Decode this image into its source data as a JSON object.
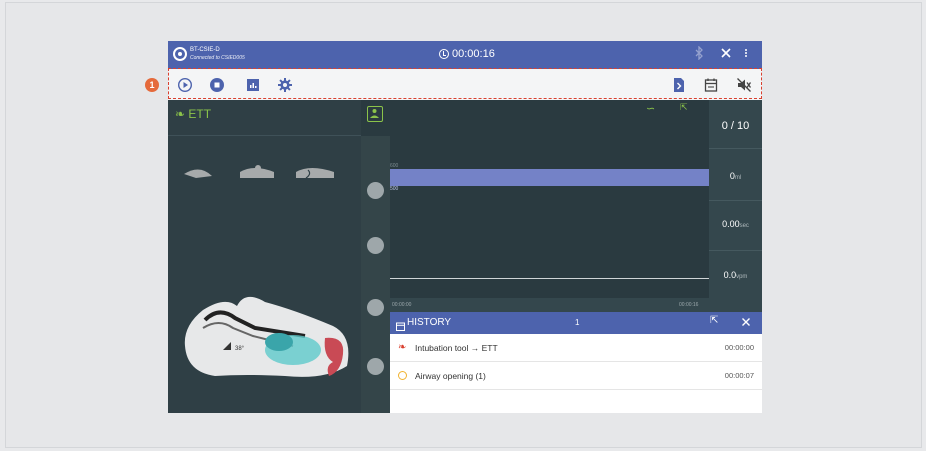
{
  "topbar": {
    "device_name": "BT-CSIE-D",
    "device_status": "Connected to CSIED005",
    "timer": "00:00:16"
  },
  "toolbar": {
    "left_icons": [
      "play-icon",
      "stop-icon",
      "report-icon",
      "settings-icon"
    ],
    "right_icons": [
      "export-icon",
      "calendar-icon",
      "mute-icon"
    ]
  },
  "annotation": {
    "badge": "1",
    "color": "#d9402f"
  },
  "left_panel": {
    "title": "ETT"
  },
  "chart": {
    "y_top_label": "600",
    "y_bottom_label": "500",
    "x_start": "00:00:00",
    "x_end": "00:00:16"
  },
  "stats": {
    "count": "0 / 10",
    "volume_value": "0",
    "volume_unit": "ml",
    "time_value": "0.00",
    "time_unit": "sec",
    "rate_value": "0.0",
    "rate_unit": "vpm"
  },
  "history": {
    "title": "HISTORY",
    "count": "1",
    "rows": [
      {
        "label": "Intubation tool → ETT",
        "time": "00:00:00",
        "icon": "ett-tool-icon"
      },
      {
        "label": "Airway opening (1)",
        "time": "00:00:07",
        "icon": "airway-icon"
      }
    ]
  },
  "colors": {
    "header": "#4d63ad",
    "accent_green": "#8bc34a",
    "panel_dark": "#2a3a40",
    "bar": "#7482c7"
  }
}
